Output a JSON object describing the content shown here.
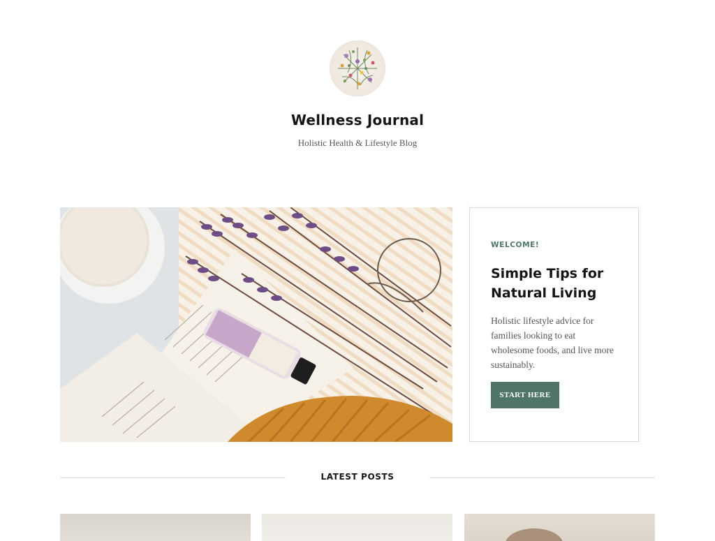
{
  "site": {
    "title": "Wellness Journal",
    "tagline": "Holistic Health & Lifestyle Blog",
    "logo_icon": "botanical-wreath-icon"
  },
  "hero": {
    "image_icon": "flatlay-lavender-book-image"
  },
  "welcome": {
    "eyebrow": "WELCOME!",
    "heading": "Simple Tips for Natural Living",
    "text": "Holistic lifestyle advice for families looking to eat wholesome foods, and live more sustainably.",
    "button_label": "START HERE",
    "accent_color": "#4e7565"
  },
  "latest_posts": {
    "heading": "LATEST POSTS",
    "posts": [
      {
        "thumbnail_icon": "post-thumbnail-image"
      },
      {
        "thumbnail_icon": "post-thumbnail-image"
      },
      {
        "thumbnail_icon": "post-thumbnail-image"
      }
    ]
  }
}
